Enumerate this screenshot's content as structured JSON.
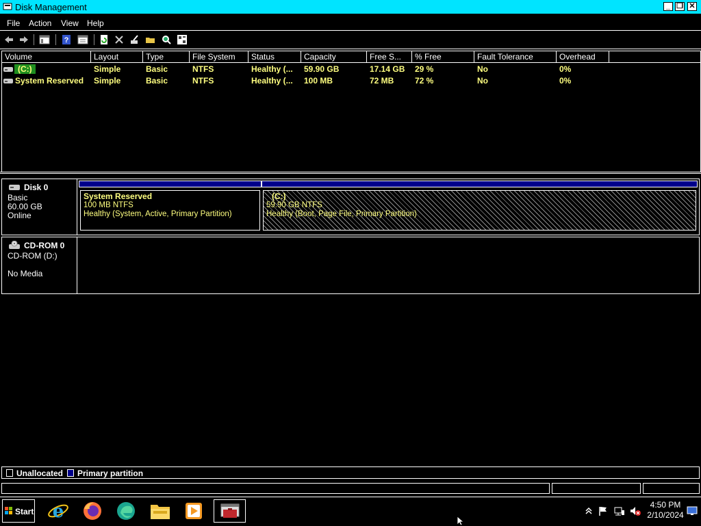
{
  "window": {
    "title": "Disk Management"
  },
  "menu": {
    "items": [
      "File",
      "Action",
      "View",
      "Help"
    ]
  },
  "toolbar": {
    "icons": [
      "back-icon",
      "forward-icon",
      "console-tree-icon",
      "help-icon",
      "properties-icon",
      "refresh-icon",
      "delete-icon",
      "wizard-icon",
      "open-icon",
      "search-icon",
      "rescan-icon"
    ]
  },
  "volumes": {
    "columns": [
      "Volume",
      "Layout",
      "Type",
      "File System",
      "Status",
      "Capacity",
      "Free S...",
      "% Free",
      "Fault Tolerance",
      "Overhead"
    ],
    "rows": [
      {
        "volume": "(C:)",
        "layout": "Simple",
        "type": "Basic",
        "fs": "NTFS",
        "status": "Healthy (...",
        "capacity": "59.90 GB",
        "free": "17.14 GB",
        "pct_free": "29 %",
        "fault": "No",
        "overhead": "0%"
      },
      {
        "volume": "System Reserved",
        "layout": "Simple",
        "type": "Basic",
        "fs": "NTFS",
        "status": "Healthy (...",
        "capacity": "100 MB",
        "free": "72 MB",
        "pct_free": "72 %",
        "fault": "No",
        "overhead": "0%"
      }
    ]
  },
  "disks": [
    {
      "name": "Disk 0",
      "kind": "Basic",
      "size": "60.00 GB",
      "state": "Online",
      "partitions": [
        {
          "title": "System Reserved",
          "line1": "100 MB NTFS",
          "line2": "Healthy (System, Active, Primary Partition)"
        },
        {
          "title": "(C:)",
          "line1": "59.90 GB NTFS",
          "line2": "Healthy (Boot, Page File, Primary Partition)"
        }
      ]
    },
    {
      "name": "CD-ROM 0",
      "kind": "CD-ROM (D:)",
      "media": "No Media"
    }
  ],
  "legend": {
    "unallocated": "Unallocated",
    "primary": "Primary partition",
    "primary_color": "#00008b"
  },
  "taskbar": {
    "start_label": "Start",
    "apps": [
      "internet-explorer-icon",
      "firefox-icon",
      "edge-icon",
      "file-explorer-icon",
      "media-player-icon",
      "computer-management-icon"
    ],
    "clock_time": "4:50 PM",
    "clock_date": "2/10/2024"
  },
  "colors": {
    "titlebar": "#00e4ff",
    "volume_text": "#ffff80",
    "selection": "#1f8f1f"
  }
}
